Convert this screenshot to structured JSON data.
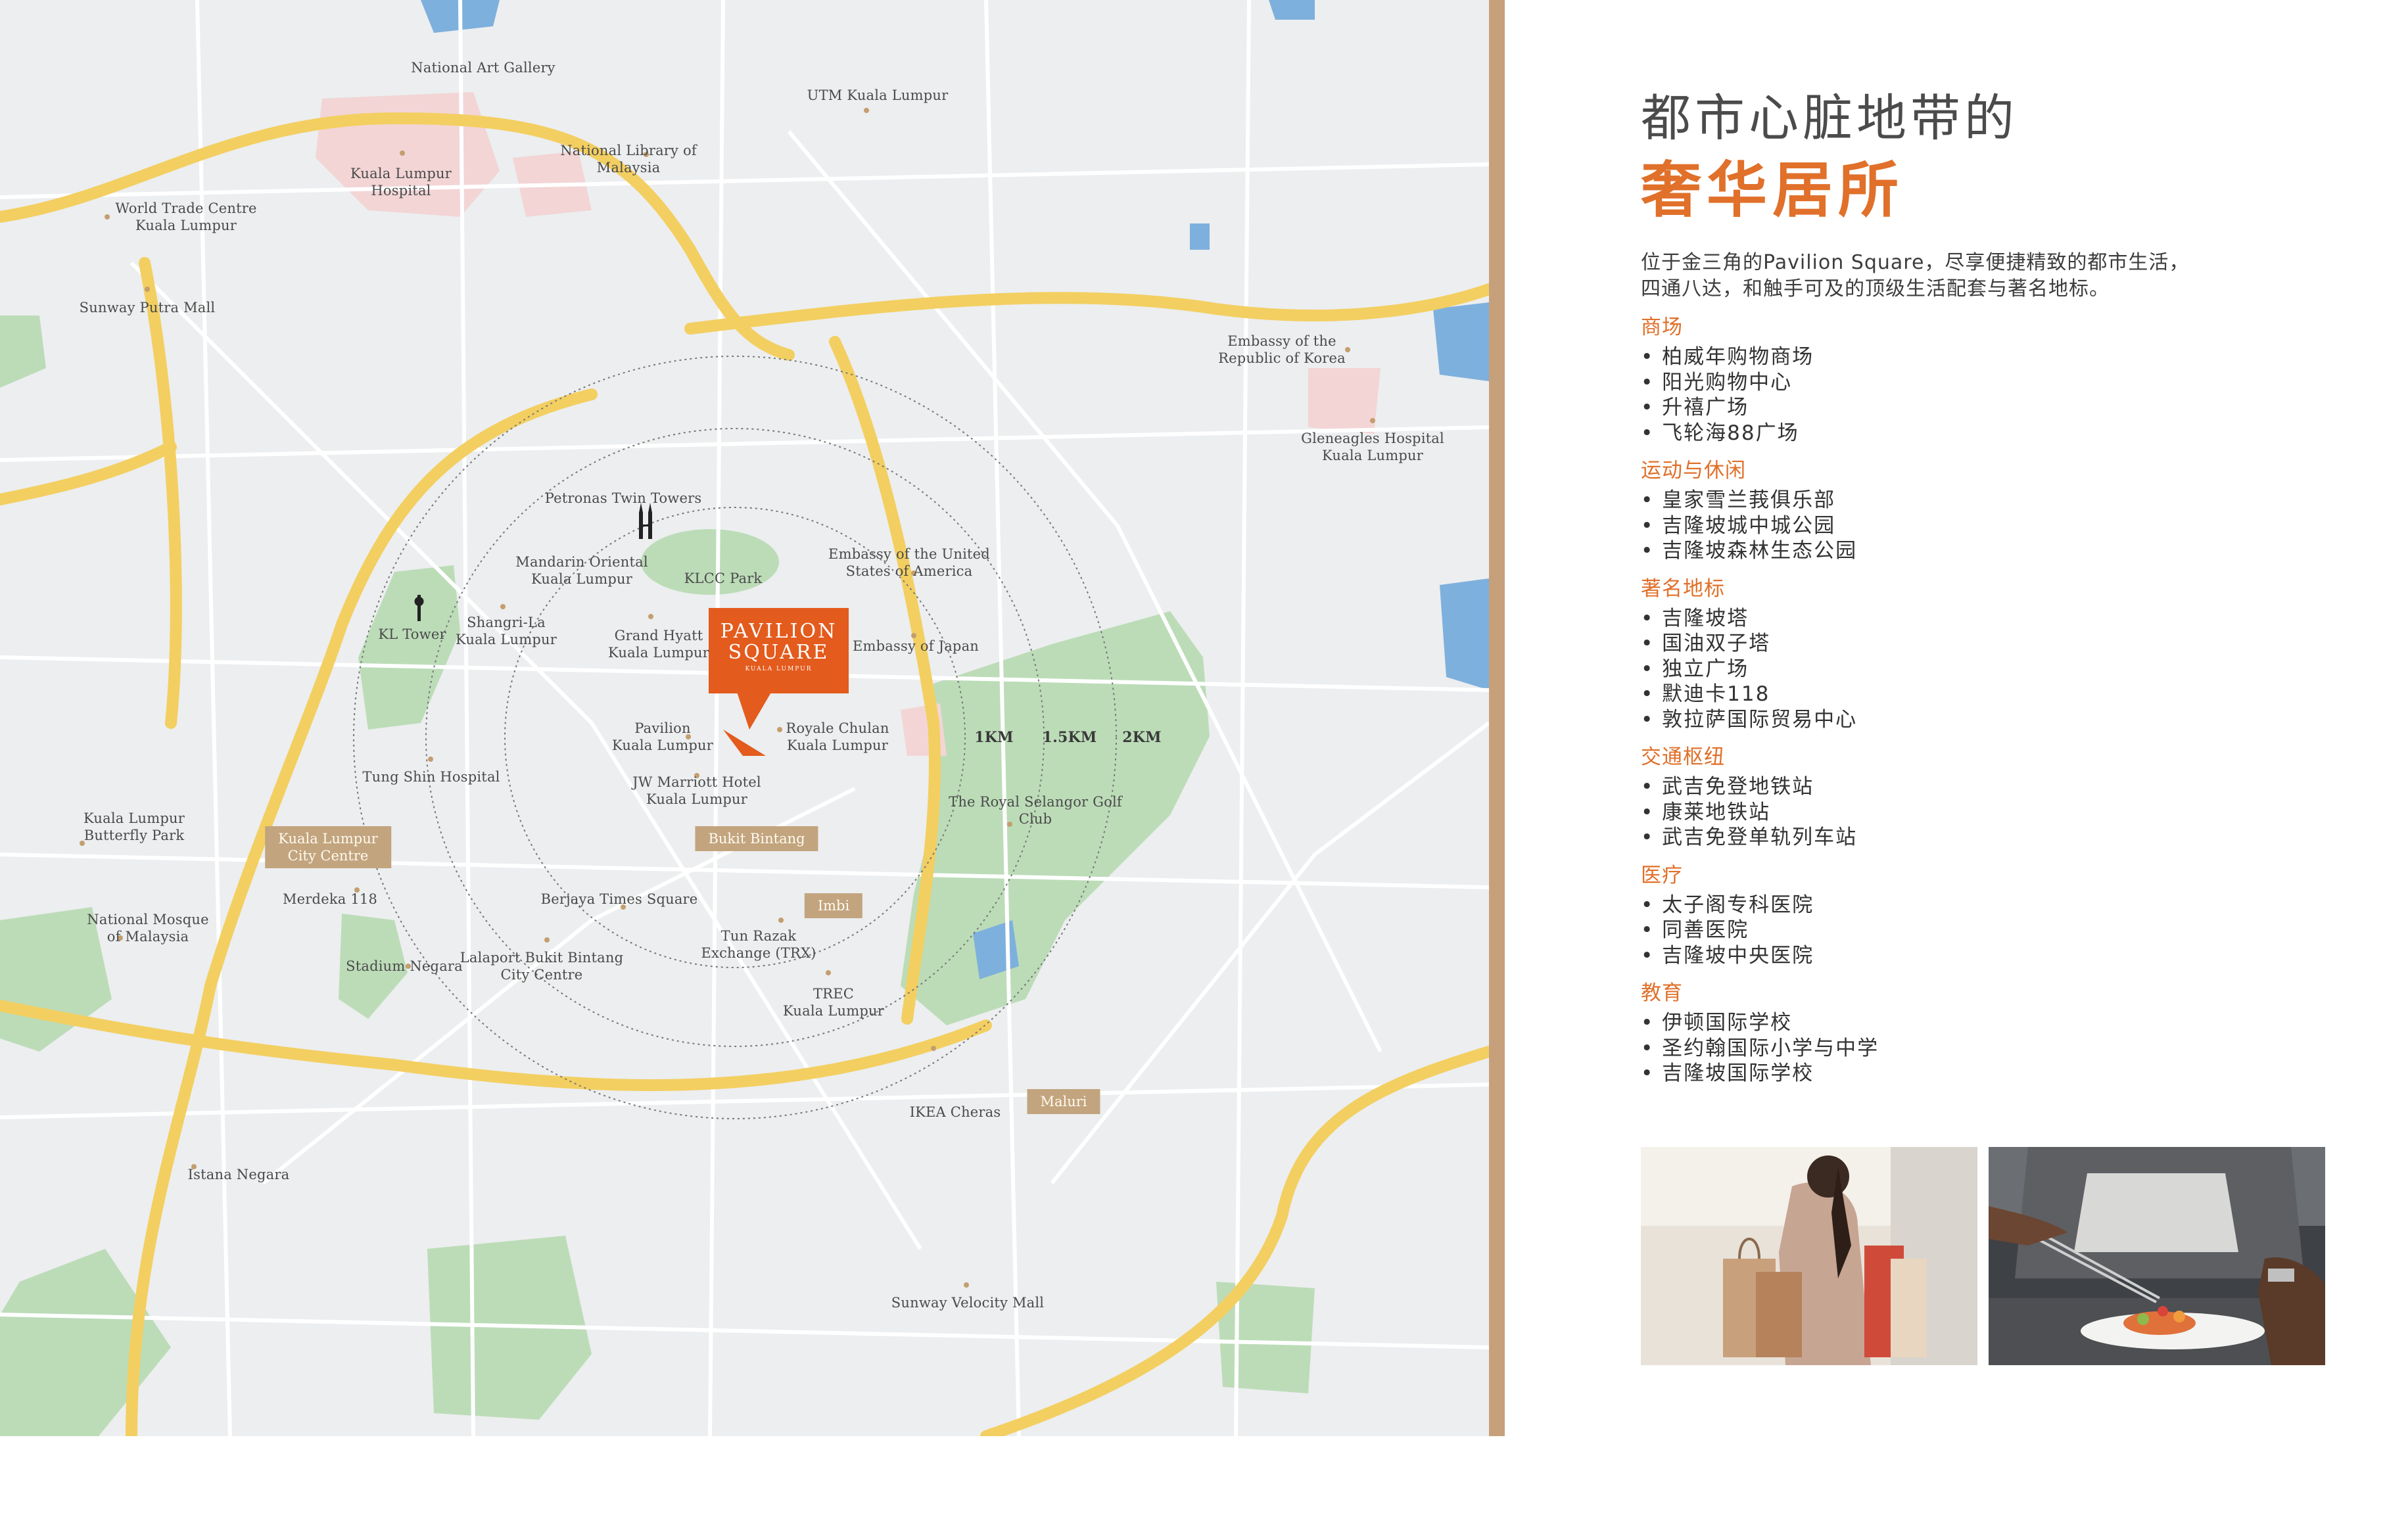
{
  "map": {
    "logo": {
      "line1": "PAVILION",
      "line2": "SQUARE",
      "line3": "KUALA LUMPUR"
    },
    "rings": [
      "1KM",
      "1.5KM",
      "2KM"
    ],
    "landmarks": [
      "National Art Gallery",
      "UTM Kuala Lumpur",
      "Kuala Lumpur\nHospital",
      "National Library of\nMalaysia",
      "World Trade Centre\nKuala Lumpur",
      "Sunway Putra Mall",
      "Embassy of the\nRepublic of Korea",
      "Gleneagles Hospital\nKuala Lumpur",
      "Petronas Twin Towers",
      "Mandarin Oriental\nKuala Lumpur",
      "KLCC Park",
      "Embassy of the United\nStates of America",
      "KL Tower",
      "Shangri-La\nKuala Lumpur",
      "Grand Hyatt\nKuala Lumpur",
      "Embassy of Japan",
      "Pavilion\nKuala Lumpur",
      "Royale Chulan\nKuala Lumpur",
      "Tung Shin Hospital",
      "JW Marriott Hotel\nKuala Lumpur",
      "The Royal Selangor Golf\nClub",
      "Kuala Lumpur\nButterfly Park",
      "Merdeka 118",
      "Berjaya Times Square",
      "National Mosque\nof Malaysia",
      "Stadium Negara",
      "Lalaport Bukit Bintang\nCity Centre",
      "Tun Razak\nExchange (TRX)",
      "TREC\nKuala Lumpur",
      "IKEA Cheras",
      "Istana Negara",
      "Sunway Velocity Mall"
    ],
    "districts": [
      "Kuala Lumpur\nCity Centre",
      "Bukit Bintang",
      "Imbi",
      "Maluri"
    ]
  },
  "headline": {
    "line1": "都市心脏地带的",
    "line2": "奢华居所"
  },
  "intro": {
    "line1": "位于金三角的Pavilion Square，尽享便捷精致的都市生活，",
    "line2": "四通八达，和触手可及的顶级生活配套与著名地标。"
  },
  "sections": [
    {
      "title": "商场",
      "items": [
        "柏威年购物商场",
        "阳光购物中心",
        "升禧广场",
        "飞轮海88广场"
      ]
    },
    {
      "title": "运动与休闲",
      "items": [
        "皇家雪兰莪俱乐部",
        "吉隆坡城中城公园",
        "吉隆坡森林生态公园"
      ]
    },
    {
      "title": "著名地标",
      "items": [
        "吉隆坡塔",
        "国油双子塔",
        "独立广场",
        "默迪卡118",
        "敦拉萨国际贸易中心"
      ]
    },
    {
      "title": "交通枢纽",
      "items": [
        "武吉免登地铁站",
        "康莱地铁站",
        "武吉免登单轨列车站"
      ]
    },
    {
      "title": "医疗",
      "items": [
        "太子阁专科医院",
        "同善医院",
        "吉隆坡中央医院"
      ]
    },
    {
      "title": "教育",
      "items": [
        "伊顿国际学校",
        "圣约翰国际小学与中学",
        "吉隆坡国际学校"
      ]
    }
  ],
  "colors": {
    "accent": "#e0702a",
    "gold": "#c6a07a",
    "road": "#f5d56e",
    "park": "#b9dcb6",
    "water": "#7eb0dd"
  },
  "photos": [
    "shopping-photo",
    "chef-plating-photo"
  ]
}
